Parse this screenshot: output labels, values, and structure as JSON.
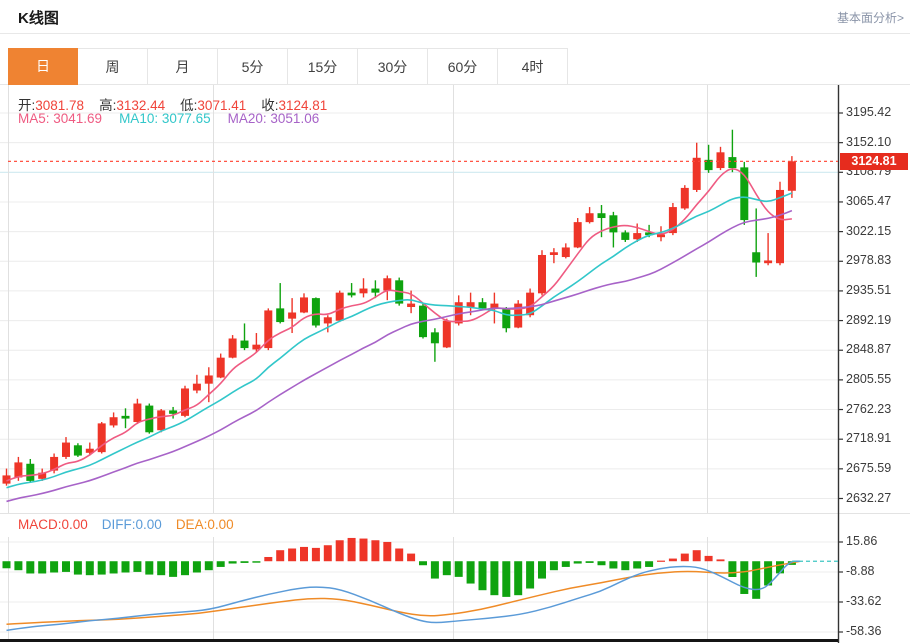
{
  "header": {
    "title": "K线图",
    "analysis_link": "基本面分析>"
  },
  "tabs": {
    "items": [
      "日",
      "周",
      "月",
      "5分",
      "15分",
      "30分",
      "60分",
      "4时"
    ],
    "selected_index": 0
  },
  "legend": {
    "ohlc": [
      {
        "label": "开:",
        "value": "3081.78"
      },
      {
        "label": "高:",
        "value": "3132.44"
      },
      {
        "label": "低:",
        "value": "3071.41"
      },
      {
        "label": "收:",
        "value": "3124.81"
      }
    ],
    "ma": [
      {
        "label": "MA5:",
        "value": "3041.69",
        "color": "#ef5b82"
      },
      {
        "label": "MA10:",
        "value": "3077.65",
        "color": "#32c7ca"
      },
      {
        "label": "MA20:",
        "value": "3051.06",
        "color": "#a763c8"
      }
    ],
    "macd": [
      {
        "label": "MACD:",
        "value": "0.00",
        "color": "#f0443a"
      },
      {
        "label": "DIFF:",
        "value": "0.00",
        "color": "#5b9bd8"
      },
      {
        "label": "DEA:",
        "value": "0.00",
        "color": "#ef8b27"
      }
    ]
  },
  "price_marker": {
    "value": "3124.81"
  },
  "colors": {
    "up": "#ee3528",
    "down": "#0fa30f",
    "ma5": "#ef5b82",
    "ma10": "#32c7ca",
    "ma20": "#a763c8",
    "diff": "#5b9bd8",
    "dea": "#ef8b27",
    "dotted_line": "#ff4a3a",
    "price_box": "#e62c1e",
    "zero_dash": "#3fc6c2",
    "tab_active": "#ef8332",
    "grid": "#ececec",
    "vgrid": "#e0e0e0",
    "grid_special": "#cfe9f0",
    "axis": "#333333",
    "value_red": "#f0443a"
  },
  "chart_data": {
    "type": "candlestick+macd",
    "title": "K线图",
    "y_axis": {
      "ticks": [
        3195.42,
        3152.1,
        3108.79,
        3065.47,
        3022.15,
        2978.83,
        2935.51,
        2892.19,
        2848.87,
        2805.55,
        2762.23,
        2718.91,
        2675.59,
        2632.27
      ]
    },
    "current_price": 3124.81,
    "ma_periods": [
      5,
      10,
      20
    ],
    "candles": [
      [
        2654,
        2676,
        2651,
        2666
      ],
      [
        2663,
        2693,
        2658,
        2685
      ],
      [
        2683,
        2690,
        2656,
        2658
      ],
      [
        2661,
        2676,
        2658,
        2670
      ],
      [
        2673,
        2698,
        2669,
        2693
      ],
      [
        2693,
        2722,
        2690,
        2714
      ],
      [
        2710,
        2713,
        2693,
        2695
      ],
      [
        2699,
        2714,
        2695,
        2705
      ],
      [
        2700,
        2744,
        2698,
        2742
      ],
      [
        2739,
        2758,
        2736,
        2751
      ],
      [
        2753,
        2764,
        2735,
        2749
      ],
      [
        2744,
        2778,
        2741,
        2771
      ],
      [
        2768,
        2771,
        2727,
        2729
      ],
      [
        2732,
        2763,
        2729,
        2761
      ],
      [
        2761,
        2766,
        2749,
        2756
      ],
      [
        2753,
        2797,
        2751,
        2793
      ],
      [
        2790,
        2813,
        2786,
        2800
      ],
      [
        2800,
        2824,
        2773,
        2812
      ],
      [
        2809,
        2844,
        2808,
        2838
      ],
      [
        2838,
        2871,
        2837,
        2866
      ],
      [
        2863,
        2888,
        2849,
        2852
      ],
      [
        2850,
        2874,
        2846,
        2857
      ],
      [
        2852,
        2910,
        2849,
        2907
      ],
      [
        2910,
        2947,
        2888,
        2890
      ],
      [
        2895,
        2925,
        2874,
        2904
      ],
      [
        2904,
        2932,
        2903,
        2926
      ],
      [
        2925,
        2926,
        2882,
        2885
      ],
      [
        2888,
        2900,
        2875,
        2897
      ],
      [
        2892,
        2936,
        2890,
        2933
      ],
      [
        2933,
        2947,
        2926,
        2929
      ],
      [
        2932,
        2954,
        2926,
        2939
      ],
      [
        2939,
        2951,
        2925,
        2933
      ],
      [
        2936,
        2958,
        2922,
        2954
      ],
      [
        2951,
        2955,
        2914,
        2917
      ],
      [
        2912,
        2936,
        2903,
        2917
      ],
      [
        2914,
        2917,
        2866,
        2868
      ],
      [
        2875,
        2881,
        2832,
        2859
      ],
      [
        2853,
        2895,
        2852,
        2892
      ],
      [
        2888,
        2929,
        2885,
        2919
      ],
      [
        2912,
        2933,
        2900,
        2919
      ],
      [
        2919,
        2925,
        2907,
        2910
      ],
      [
        2910,
        2933,
        2888,
        2917
      ],
      [
        2910,
        2912,
        2875,
        2881
      ],
      [
        2882,
        2922,
        2881,
        2917
      ],
      [
        2900,
        2939,
        2897,
        2933
      ],
      [
        2932,
        2995,
        2929,
        2988
      ],
      [
        2988,
        2998,
        2976,
        2992
      ],
      [
        2985,
        3005,
        2983,
        2999
      ],
      [
        2999,
        3042,
        2998,
        3036
      ],
      [
        3036,
        3058,
        3034,
        3049
      ],
      [
        3049,
        3061,
        3014,
        3042
      ],
      [
        3046,
        3051,
        2999,
        3021
      ],
      [
        3021,
        3024,
        3007,
        3010
      ],
      [
        3011,
        3034,
        3007,
        3020
      ],
      [
        3021,
        3032,
        3014,
        3017
      ],
      [
        3014,
        3030,
        3008,
        3018
      ],
      [
        3020,
        3064,
        3017,
        3058
      ],
      [
        3056,
        3090,
        3054,
        3086
      ],
      [
        3083,
        3152,
        3080,
        3130
      ],
      [
        3127,
        3149,
        3108,
        3112
      ],
      [
        3115,
        3146,
        3112,
        3138
      ],
      [
        3131,
        3171,
        3109,
        3115
      ],
      [
        3116,
        3124,
        3032,
        3039
      ],
      [
        2992,
        3056,
        2956,
        2977
      ],
      [
        2976,
        3020,
        2973,
        2980
      ],
      [
        2976,
        3095,
        2973,
        3083
      ],
      [
        3081.78,
        3132.44,
        3071.41,
        3124.81
      ]
    ],
    "macd": {
      "y_axis": {
        "ticks": [
          15.86,
          -8.88,
          -33.62,
          -58.36
        ]
      },
      "histogram": [
        -5.8,
        -7.4,
        -10.1,
        -10.1,
        -9.3,
        -8.8,
        -11.0,
        -11.5,
        -11.0,
        -10.1,
        -9.3,
        -8.8,
        -11.0,
        -11.5,
        -12.9,
        -11.5,
        -9.3,
        -7.4,
        -4.7,
        -1.9,
        -1.4,
        -1.2,
        3.5,
        9.1,
        10.5,
        11.8,
        11.0,
        13.2,
        17.3,
        19.2,
        18.7,
        17.3,
        15.9,
        10.5,
        6.3,
        -3.3,
        -14.3,
        -11.5,
        -12.9,
        -18.4,
        -23.9,
        -28.0,
        -29.4,
        -28.0,
        -22.5,
        -14.3,
        -7.4,
        -4.7,
        -1.9,
        -1.4,
        -3.3,
        -6.0,
        -7.4,
        -6.0,
        -4.7,
        0.5,
        2.2,
        6.3,
        9.1,
        4.4,
        1.5,
        -13.0,
        -27.0,
        -31.0,
        -20.0,
        -10.0,
        -3.0
      ],
      "diff_points": [
        [
          0,
          -57
        ],
        [
          2,
          -54
        ],
        [
          4.5,
          -52
        ],
        [
          7,
          -49
        ],
        [
          9.5,
          -47
        ],
        [
          12,
          -44
        ],
        [
          14.6,
          -42
        ],
        [
          17.1,
          -40
        ],
        [
          19.6,
          -33
        ],
        [
          22.1,
          -27
        ],
        [
          24.7,
          -22
        ],
        [
          26.3,
          -21
        ],
        [
          28,
          -23
        ],
        [
          30.5,
          -32
        ],
        [
          33,
          -43
        ],
        [
          34.7,
          -49
        ],
        [
          36,
          -51
        ],
        [
          38.1,
          -49
        ],
        [
          40.6,
          -47
        ],
        [
          43.2,
          -44
        ],
        [
          45.7,
          -38
        ],
        [
          48.2,
          -30
        ],
        [
          49.9,
          -25
        ],
        [
          51.6,
          -17
        ],
        [
          53.2,
          -10
        ],
        [
          54.9,
          -6
        ],
        [
          56.6,
          -4
        ],
        [
          58.3,
          -5
        ],
        [
          60,
          -12
        ],
        [
          62,
          -22.5
        ],
        [
          63.5,
          -24
        ],
        [
          64.5,
          -15
        ],
        [
          65.8,
          0
        ],
        [
          66.7,
          0
        ]
      ],
      "dea_points": [
        [
          0,
          -52
        ],
        [
          2.8,
          -50.5
        ],
        [
          6.2,
          -49
        ],
        [
          9.5,
          -48
        ],
        [
          12.9,
          -45.5
        ],
        [
          16.3,
          -43
        ],
        [
          19.6,
          -38
        ],
        [
          23,
          -33.5
        ],
        [
          25.5,
          -30.5
        ],
        [
          28,
          -31
        ],
        [
          30.5,
          -36
        ],
        [
          33,
          -42
        ],
        [
          35.2,
          -45.5
        ],
        [
          37.3,
          -44
        ],
        [
          39.8,
          -40
        ],
        [
          42.3,
          -34
        ],
        [
          44.8,
          -28
        ],
        [
          47.4,
          -22
        ],
        [
          49.9,
          -18
        ],
        [
          52.4,
          -13
        ],
        [
          54.9,
          -9.5
        ],
        [
          57.4,
          -8
        ],
        [
          60,
          -10
        ],
        [
          62,
          -9
        ],
        [
          63.5,
          -6
        ],
        [
          65,
          -3
        ],
        [
          66.7,
          0
        ]
      ],
      "zero_line_value": 0
    }
  }
}
